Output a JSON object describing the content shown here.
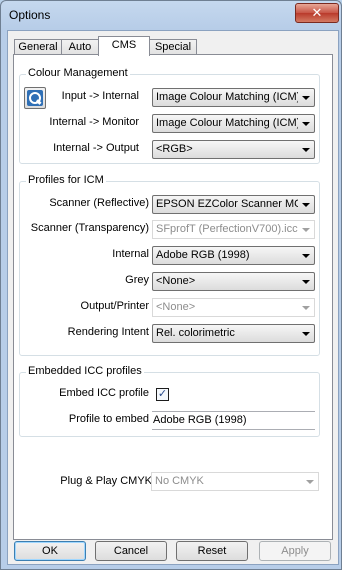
{
  "window": {
    "title": "Options",
    "close_glyph": "✕"
  },
  "tabs": [
    {
      "label": "General",
      "active": false
    },
    {
      "label": "Auto",
      "active": false
    },
    {
      "label": "CMS",
      "active": true
    },
    {
      "label": "Special",
      "active": false
    }
  ],
  "colour_management": {
    "title": "Colour Management",
    "icon": "colour-management-icon",
    "input_internal": {
      "label": "Input -> Internal",
      "value": "Image Colour Matching (ICM)"
    },
    "internal_monitor": {
      "label": "Internal -> Monitor",
      "value": "Image Colour Matching (ICM)"
    },
    "internal_output": {
      "label": "Internal -> Output",
      "value": "<RGB>"
    }
  },
  "profiles": {
    "title": "Profiles for ICM",
    "scanner_reflective": {
      "label": "Scanner (Reflective)",
      "value": "EPSON EZColor Scanner MO"
    },
    "scanner_transparency": {
      "label": "Scanner (Transparency)",
      "value": "SFprofT (PerfectionV700).icc"
    },
    "internal": {
      "label": "Internal",
      "value": "Adobe RGB (1998)"
    },
    "grey": {
      "label": "Grey",
      "value": "<None>"
    },
    "output_printer": {
      "label": "Output/Printer",
      "value": "<None>"
    },
    "rendering_intent": {
      "label": "Rendering Intent",
      "value": "Rel. colorimetric"
    }
  },
  "embedded": {
    "title": "Embedded ICC profiles",
    "embed_label": "Embed ICC profile",
    "embed_checked": true,
    "embed_check_glyph": "✓",
    "profile_label": "Profile to embed",
    "profile_value": "Adobe RGB (1998)"
  },
  "plug_play": {
    "label": "Plug & Play CMYK",
    "value": "No CMYK"
  },
  "buttons": {
    "ok": "OK",
    "cancel": "Cancel",
    "reset": "Reset",
    "apply": "Apply"
  }
}
